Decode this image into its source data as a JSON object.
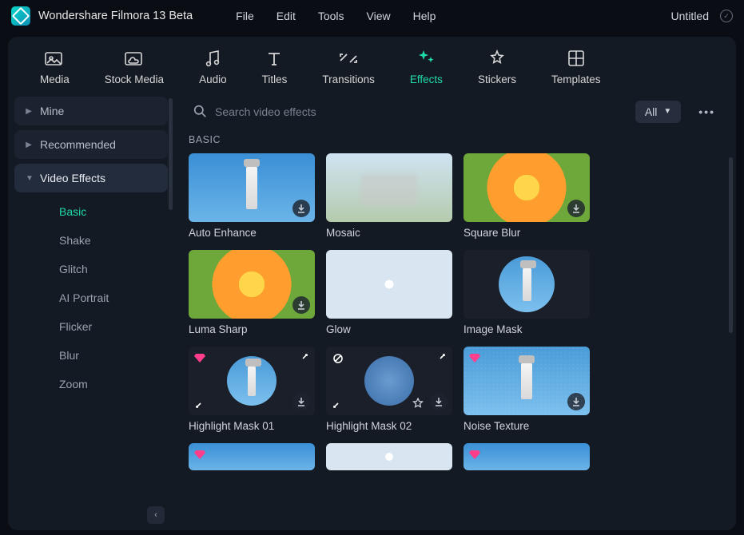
{
  "app": {
    "title": "Wondershare Filmora 13 Beta",
    "document": "Untitled"
  },
  "menu": {
    "file": "File",
    "edit": "Edit",
    "tools": "Tools",
    "view": "View",
    "help": "Help"
  },
  "tabs": {
    "media": "Media",
    "stock": "Stock Media",
    "audio": "Audio",
    "titles": "Titles",
    "transitions": "Transitions",
    "effects": "Effects",
    "stickers": "Stickers",
    "templates": "Templates"
  },
  "sidebar": {
    "mine": "Mine",
    "recommended": "Recommended",
    "videoEffects": "Video Effects",
    "subs": {
      "basic": "Basic",
      "shake": "Shake",
      "glitch": "Glitch",
      "aiPortrait": "AI Portrait",
      "flicker": "Flicker",
      "blur": "Blur",
      "zoom": "Zoom"
    }
  },
  "toolbar": {
    "searchPlaceholder": "Search video effects",
    "filter": "All"
  },
  "section": {
    "basic": "BASIC"
  },
  "effects": {
    "autoEnhance": "Auto Enhance",
    "mosaic": "Mosaic",
    "squareBlur": "Square Blur",
    "lumaSharp": "Luma Sharp",
    "glow": "Glow",
    "imageMask": "Image Mask",
    "highlightMask01": "Highlight Mask 01",
    "highlightMask02": "Highlight Mask 02",
    "noiseTexture": "Noise Texture"
  }
}
